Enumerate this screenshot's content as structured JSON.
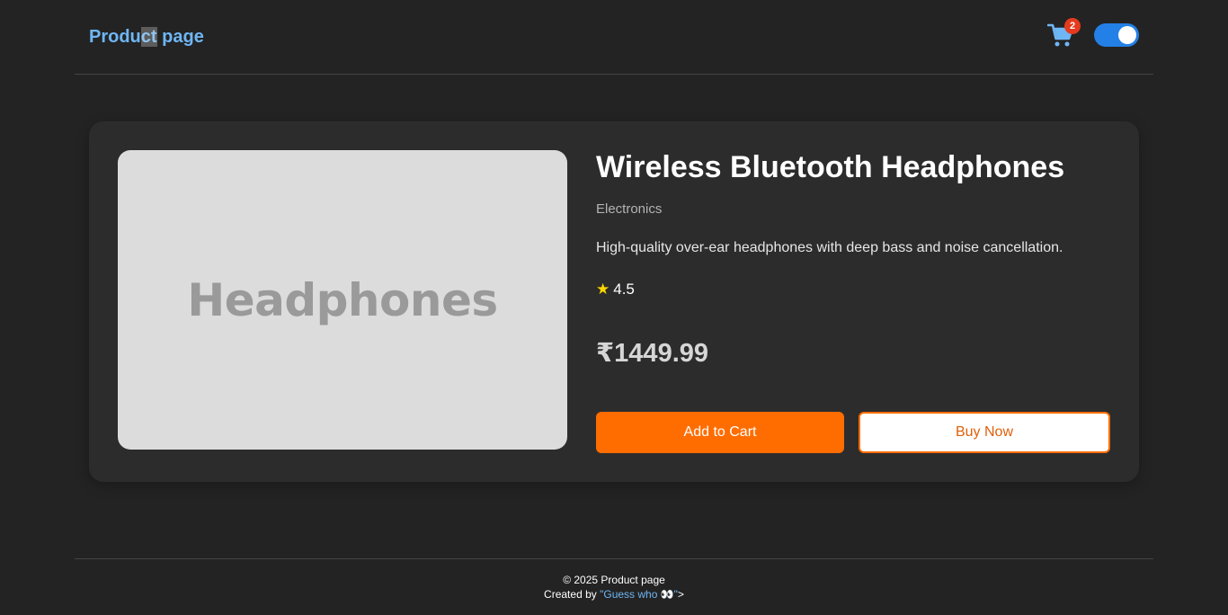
{
  "header": {
    "brand_part1": "Produ",
    "brand_selected": "ct",
    "brand_part2": " page",
    "cart_count": "2",
    "theme_toggle": "on"
  },
  "product": {
    "image_label": "Headphones",
    "title": "Wireless Bluetooth Headphones",
    "category": "Electronics",
    "description": "High-quality over-ear headphones with deep bass and noise cancellation.",
    "rating_icon": "★",
    "rating": "4.5",
    "price": "₹1449.99",
    "add_to_cart_label": "Add to Cart",
    "buy_now_label": "Buy Now"
  },
  "footer": {
    "copyright": "© 2025 Product page",
    "created_by_prefix": "Created by ",
    "author_link": "\"Guess who 👀\"",
    "suffix": ">"
  },
  "colors": {
    "background": "#232323",
    "card": "#2c2c2c",
    "accent_orange": "#ff6d00",
    "link_blue": "#6fb6f5",
    "toggle_blue": "#2380e6",
    "badge_red": "#e53a1e",
    "star_yellow": "#ffd700"
  },
  "icons": {
    "cart": "shopping-cart-icon",
    "rating": "star-icon"
  }
}
